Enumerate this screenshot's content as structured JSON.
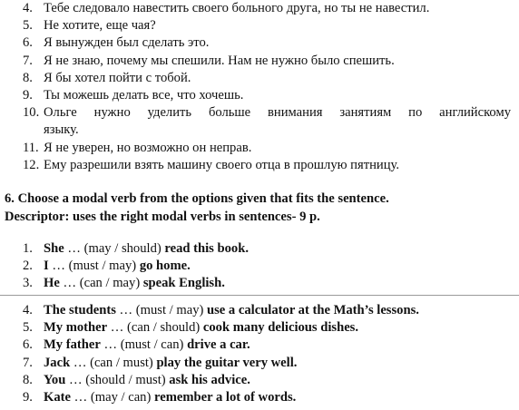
{
  "russian_items": [
    {
      "num": "4.",
      "text": "Тебе следовало навестить своего больного друга, но ты не навестил."
    },
    {
      "num": "5.",
      "text": "Не хотите, еще чая?"
    },
    {
      "num": "6.",
      "text": "Я вынужден был сделать это."
    },
    {
      "num": "7.",
      "text": "Я не знаю, почему мы спешили. Нам не нужно было спешить."
    },
    {
      "num": "8.",
      "text": "Я бы хотел пойти с тобой."
    },
    {
      "num": "9.",
      "text": "Ты можешь делать все, что хочешь."
    },
    {
      "num": "10.",
      "line1": "Ольге нужно уделить больше внимания занятиям по английскому",
      "line2": "языку."
    },
    {
      "num": "11.",
      "text": "Я не уверен, но возможно он неправ."
    },
    {
      "num": "12.",
      "text": "Ему разрешили взять машину своего отца в прошлую пятницу."
    }
  ],
  "task": {
    "title": "6. Choose a modal verb from the options given that fits the sentence.",
    "descriptor": "Descriptor: uses the right modal verbs in sentences- 9 p."
  },
  "exercise_part1": [
    {
      "num": "1.",
      "subject": "She",
      "options": " … (may / should) ",
      "rest": "read this book."
    },
    {
      "num": "2.",
      "subject": "I",
      "options": " … (must / may) ",
      "rest": "go home."
    },
    {
      "num": "3.",
      "subject": "He",
      "options": " … (can / may) ",
      "rest": "speak English."
    }
  ],
  "exercise_part2": [
    {
      "num": "4.",
      "subject": "The students",
      "options": " … (must / may) ",
      "rest": "use a calculator at the Math’s lessons."
    },
    {
      "num": "5.",
      "subject": "My mother",
      "options": " … (can / should) ",
      "rest": "cook many delicious dishes."
    },
    {
      "num": "6.",
      "subject": "My father",
      "options": " … (must / can) ",
      "rest": "drive a car."
    },
    {
      "num": "7.",
      "subject": "Jack",
      "options": " … (can / must) ",
      "rest": "play the guitar very well."
    },
    {
      "num": "8.",
      "subject": "You",
      "options": " … (should / must) ",
      "rest": "ask his advice."
    },
    {
      "num": "9.",
      "subject": "Kate",
      "options": " … (may / can) ",
      "rest": "remember a lot of words."
    }
  ]
}
